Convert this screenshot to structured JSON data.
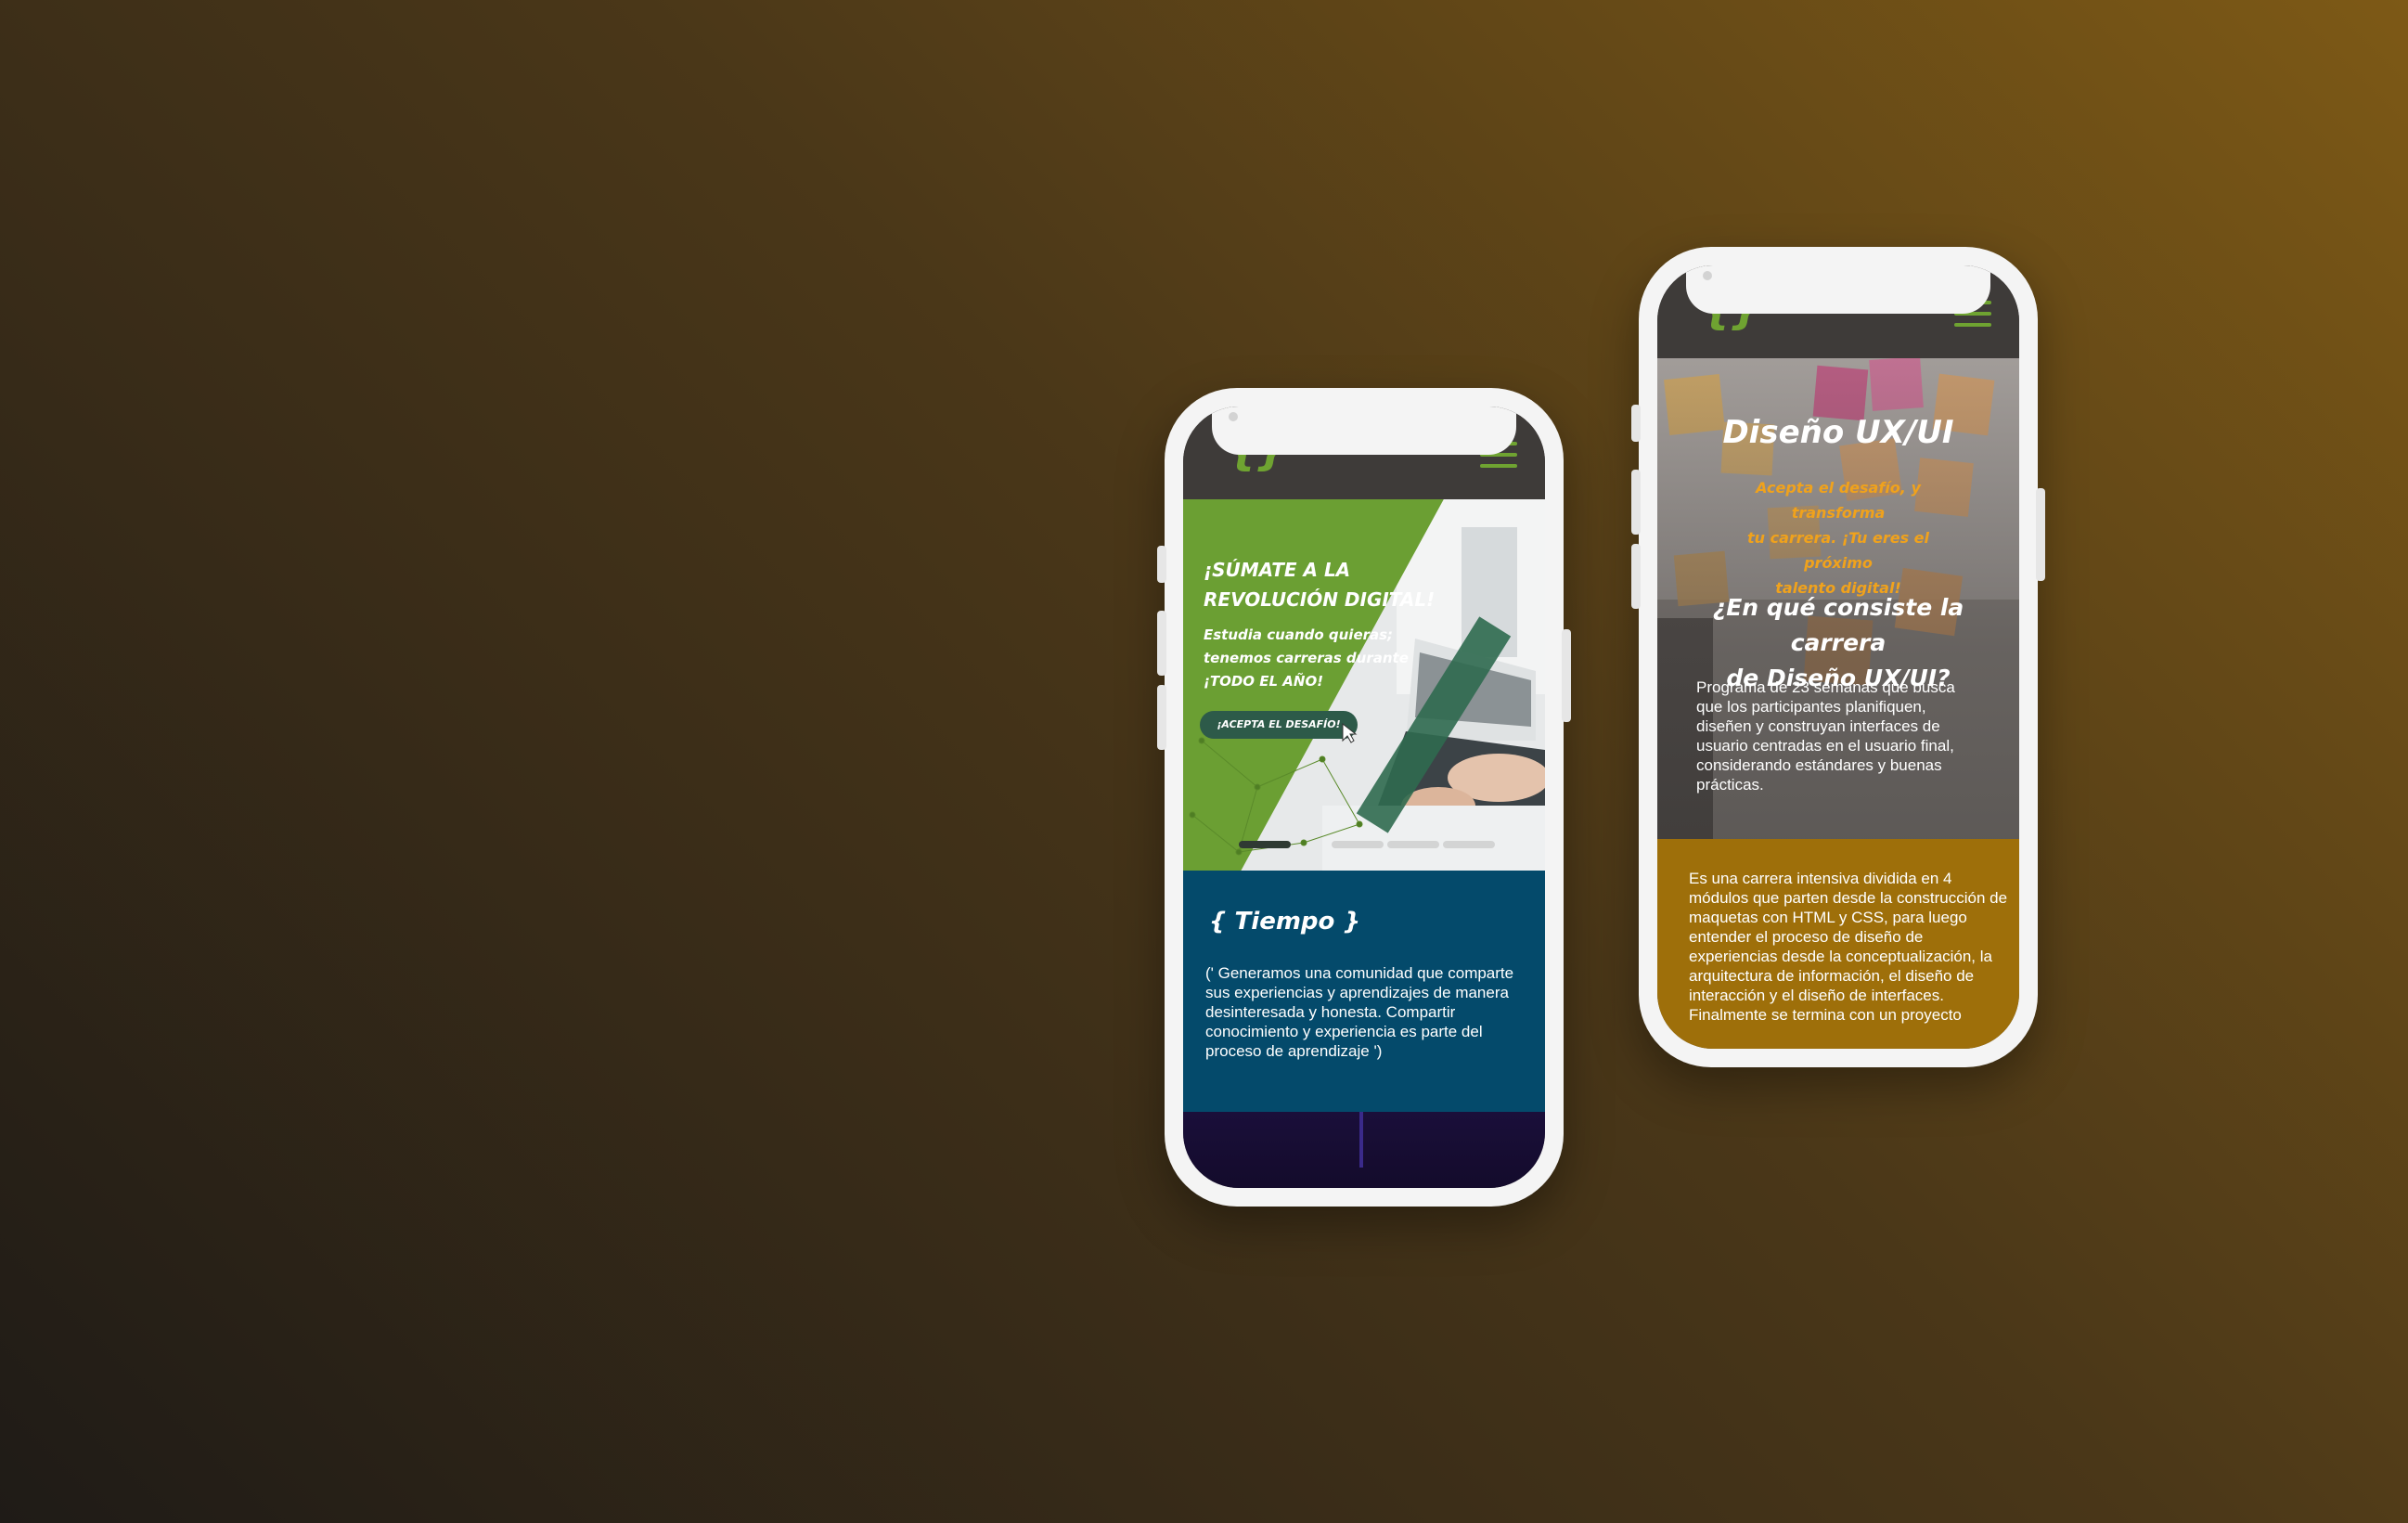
{
  "colors": {
    "brand_green": "#6fa331",
    "header_dark": "#3e3b39",
    "tiempo_blue": "#044a6b",
    "accent_orange": "#f0a21c",
    "gold_section": "#9e6f0a"
  },
  "phone1": {
    "logo": "{}",
    "menu_icon": "hamburger-menu-icon",
    "hero": {
      "title_line1": "¡SÚMATE A LA",
      "title_line2": "REVOLUCIÓN DIGITAL!",
      "subtitle_line1": "Estudia cuando quieras;",
      "subtitle_line2": "tenemos carreras durante",
      "subtitle_line3": "¡TODO EL AÑO!",
      "cta_label": "¡ACEPTA EL DESAFÍO!",
      "carousel_count": 4,
      "carousel_active": 1
    },
    "tiempo": {
      "title": "{ Tiempo }",
      "text": "(' Generamos una comunidad que comparte sus experiencias y aprendizajes de manera desinteresada y honesta. Compartir conocimiento y experiencia es parte del proceso de aprendizaje ')"
    }
  },
  "phone2": {
    "logo": "{}",
    "menu_icon": "hamburger-menu-icon",
    "title": "Diseño UX/UI",
    "tagline_line1": "Acepta el desafío, y transforma",
    "tagline_line2": "tu carrera. ¡Tu eres el próximo",
    "tagline_line3": "talento digital!",
    "question_line1": "¿En qué consiste la carrera",
    "question_line2": "de Diseño UX/UI?",
    "description": "Programa de 23 semanas que busca que los participantes planifiquen, diseñen y construyan interfaces de usuario centradas en el usuario final, considerando estándares y buenas prácticas.",
    "details": "Es una carrera intensiva dividida en 4 módulos que parten desde la construcción de maquetas con HTML y CSS, para luego entender el proceso de diseño de experiencias desde la conceptualización, la arquitectura de información, el diseño de interacción y el diseño de interfaces. Finalmente se termina con un proyecto"
  }
}
